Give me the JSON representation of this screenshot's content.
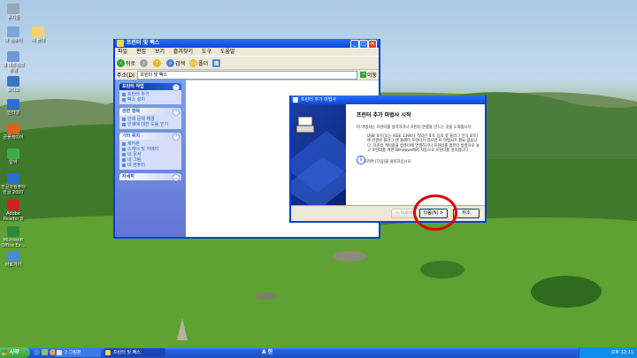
{
  "desktop_icons": [
    {
      "label": "휴지통",
      "glyph": "recycle-bin-icon",
      "color": "#9aa8b5"
    },
    {
      "label": "내 컴퓨터",
      "glyph": "computer-icon",
      "color": "#7aa6d8"
    },
    {
      "label": "새 폴더",
      "glyph": "folder-icon",
      "color": "#f3d27a"
    },
    {
      "label": "내 네트워크 환경",
      "glyph": "network-icon",
      "color": "#6e98d4"
    },
    {
      "label": "오디오",
      "glyph": "audio-icon",
      "color": "#3a76c4"
    },
    {
      "label": "인터넷",
      "glyph": "internet-icon",
      "color": "#2f6fd0"
    },
    {
      "label": "곰플레이어",
      "glyph": "player-icon",
      "color": "#e06020"
    },
    {
      "label": "알약",
      "glyph": "antivirus-icon",
      "color": "#3fae4a"
    },
    {
      "label": "한글과컴퓨터 한글 2007",
      "glyph": "hwp-icon",
      "color": "#2a6fd0"
    },
    {
      "label": "Adobe Reader 8",
      "glyph": "pdf-icon",
      "color": "#d42020"
    },
    {
      "label": "Microsoft Office Ex...",
      "glyph": "excel-icon",
      "color": "#2e8a3a"
    },
    {
      "label": "바로가기",
      "glyph": "shortcut-icon",
      "color": "#4a8ad8"
    }
  ],
  "explorer": {
    "title": "프린터 및 팩스",
    "menu": [
      "파일",
      "편집",
      "보기",
      "즐겨찾기",
      "도구",
      "도움말"
    ],
    "toolbar": {
      "back": "뒤로",
      "search": "검색",
      "folders": "폴더"
    },
    "address_label": "주소(D)",
    "address_value": "프린터 및 팩스",
    "go_label": "이동",
    "task_panels": [
      {
        "title": "프린터 작업",
        "items": [
          "프린터 추가",
          "팩스 설치"
        ]
      },
      {
        "title": "관련 항목",
        "items": [
          "인쇄 문제 해결",
          "인쇄에 대한 도움 얻기"
        ]
      },
      {
        "title": "기타 위치",
        "items": [
          "제어판",
          "스캐너 및 카메라",
          "내 문서",
          "내 그림",
          "내 컴퓨터"
        ]
      },
      {
        "title": "자세히",
        "items": []
      }
    ]
  },
  "wizard": {
    "title": "프린터 추가 마법사",
    "heading": "프린터 추가 마법사 시작",
    "intro": "이 마법사는 프린터를 설치하거나 프린터 연결을 만드는 것을 도와줍니다.",
    "info_text": "USB 포트(또는 IEEE 1394나 적외선 포트 등의 핫 플러그 인식 포트)에 연결된 플러그 앤 플레이 프린터가 있으면 이 마법사가 필요 없습니다. 프린터 케이블을 컴퓨터에 연결하거나 프린터를 컴퓨터 방향으로 놓고 프린터를 켜면 Windows에서 자동으로 프린터를 설치합니다.",
    "continue_text": "계속하려면 [다음]을 클릭하십시오.",
    "buttons": {
      "back": "< 뒤로(B)",
      "next": "다음(N) >",
      "cancel": "취소"
    }
  },
  "taskbar": {
    "start_label": "시작",
    "tasks": [
      "2 그림판",
      "프린터 및 팩스"
    ],
    "language": "A 한",
    "clock": "오후 12:11"
  },
  "colors": {
    "xp_blue": "#0a3fd8",
    "highlight_circle": "#e00000",
    "start_green": "#3a9f3a"
  }
}
